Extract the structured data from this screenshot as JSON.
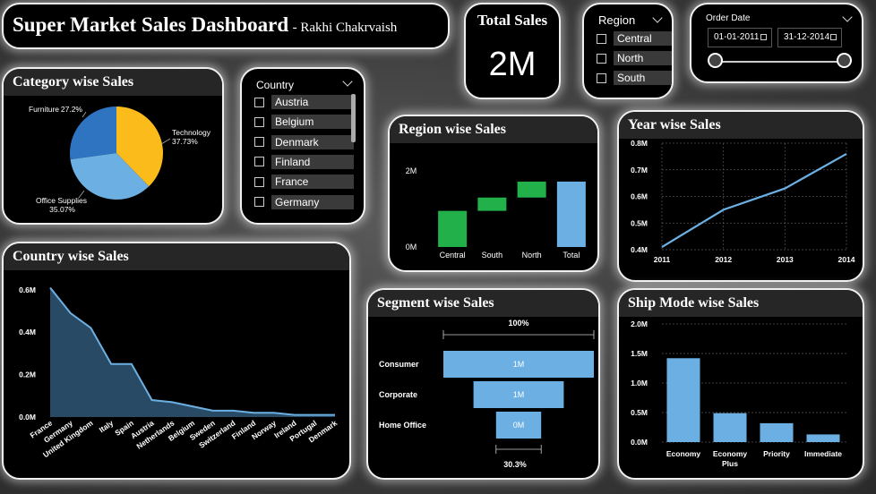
{
  "header": {
    "title": "Super Market Sales Dashboard",
    "subtitle": "- Rakhi Chakrvaish"
  },
  "kpi": {
    "title": "Total Sales",
    "value": "2M"
  },
  "region_slicer": {
    "title": "Region",
    "items": [
      "Central",
      "North",
      "South"
    ]
  },
  "date_slicer": {
    "title": "Order Date",
    "start": "01-01-2011",
    "end": "31-12-2014"
  },
  "country_slicer": {
    "title": "Country",
    "items": [
      "Austria",
      "Belgium",
      "Denmark",
      "Finland",
      "France",
      "Germany"
    ]
  },
  "colors": {
    "accent_blue": "#6cb0e3",
    "green": "#22b04a",
    "dark_blue": "#2f74c0",
    "yellow": "#fbbb1a",
    "card_bg": "#000000",
    "title_bg": "#262626"
  },
  "charts": {
    "category": {
      "title": "Category wise Sales",
      "chart_data": {
        "type": "pie",
        "slices": [
          {
            "label": "Technology",
            "value": 37.73,
            "text": "37.73%"
          },
          {
            "label": "Office Supplies",
            "value": 35.07,
            "text": "35.07%"
          },
          {
            "label": "Furniture",
            "value": 27.2,
            "text": "27.2%"
          }
        ]
      }
    },
    "region": {
      "title": "Region wise Sales",
      "chart_data": {
        "type": "bar",
        "subtype": "waterfall",
        "categories": [
          "Central",
          "South",
          "North",
          "Total"
        ],
        "values": [
          0.95,
          0.35,
          0.42,
          1.72
        ],
        "unit": "M",
        "ylim": [
          0,
          2.4
        ],
        "yticks": [
          {
            "v": 0,
            "t": "0M"
          },
          {
            "v": 2,
            "t": "2M"
          }
        ]
      }
    },
    "year": {
      "title": "Year wise Sales",
      "chart_data": {
        "type": "line",
        "x": [
          "2011",
          "2012",
          "2013",
          "2014"
        ],
        "values": [
          0.41,
          0.55,
          0.63,
          0.76
        ],
        "unit": "M",
        "ylim": [
          0.4,
          0.8
        ],
        "yticks": [
          {
            "v": 0.4,
            "t": "0.4M"
          },
          {
            "v": 0.5,
            "t": "0.5M"
          },
          {
            "v": 0.6,
            "t": "0.6M"
          },
          {
            "v": 0.7,
            "t": "0.7M"
          },
          {
            "v": 0.8,
            "t": "0.8M"
          }
        ],
        "grid": true
      }
    },
    "country": {
      "title": "Country wise Sales",
      "chart_data": {
        "type": "area",
        "categories": [
          "France",
          "Germany",
          "United Kingdom",
          "Italy",
          "Spain",
          "Austria",
          "Netherlands",
          "Belgium",
          "Sweden",
          "Switzerland",
          "Finland",
          "Norway",
          "Ireland",
          "Portugal",
          "Denmark"
        ],
        "values": [
          0.61,
          0.49,
          0.42,
          0.25,
          0.25,
          0.08,
          0.07,
          0.05,
          0.03,
          0.03,
          0.02,
          0.02,
          0.01,
          0.01,
          0.01
        ],
        "unit": "M",
        "ylim": [
          0,
          0.65
        ],
        "yticks": [
          {
            "v": 0,
            "t": "0.0M"
          },
          {
            "v": 0.2,
            "t": "0.2M"
          },
          {
            "v": 0.4,
            "t": "0.4M"
          },
          {
            "v": 0.6,
            "t": "0.6M"
          }
        ]
      }
    },
    "segment": {
      "title": "Segment wise Sales",
      "chart_data": {
        "type": "bar",
        "subtype": "funnel",
        "categories": [
          "Consumer",
          "Corporate",
          "Home Office"
        ],
        "values": [
          1.0,
          0.6,
          0.3
        ],
        "labels": [
          "1M",
          "1M",
          "0M"
        ],
        "top_pct": "100%",
        "bottom_pct": "30.3%"
      }
    },
    "shipmode": {
      "title": "Ship Mode wise Sales",
      "chart_data": {
        "type": "bar",
        "categories": [
          "Economy",
          "Economy Plus",
          "Priority",
          "Immediate"
        ],
        "category_lines": [
          [
            "Economy"
          ],
          [
            "Economy",
            "Plus"
          ],
          [
            "Priority"
          ],
          [
            "Immediate"
          ]
        ],
        "values": [
          1.42,
          0.49,
          0.32,
          0.13
        ],
        "unit": "M",
        "ylim": [
          0,
          2.0
        ],
        "yticks": [
          {
            "v": 0,
            "t": "0.0M"
          },
          {
            "v": 0.5,
            "t": "0.5M"
          },
          {
            "v": 1.0,
            "t": "1.0M"
          },
          {
            "v": 1.5,
            "t": "1.5M"
          },
          {
            "v": 2.0,
            "t": "2.0M"
          }
        ]
      }
    }
  }
}
